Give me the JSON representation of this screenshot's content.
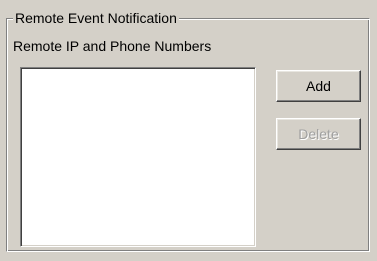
{
  "group": {
    "title": "Remote Event Notification"
  },
  "list": {
    "label": "Remote IP and Phone Numbers",
    "items": []
  },
  "buttons": {
    "add_label": "Add",
    "delete_label": "Delete",
    "delete_enabled": false
  }
}
